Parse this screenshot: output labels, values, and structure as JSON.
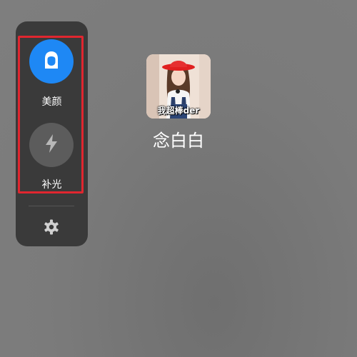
{
  "panel": {
    "items": [
      {
        "label": "美颜",
        "icon": "beauty-face-icon",
        "color": "#1e88f5",
        "active": true
      },
      {
        "label": "补光",
        "icon": "lightning-icon",
        "color": "#5c5c5c",
        "active": false
      }
    ],
    "settings_icon": "gear-icon",
    "highlight_color": "#e0262f"
  },
  "contact": {
    "avatar_caption": "我超棒der",
    "name": "念白白"
  }
}
